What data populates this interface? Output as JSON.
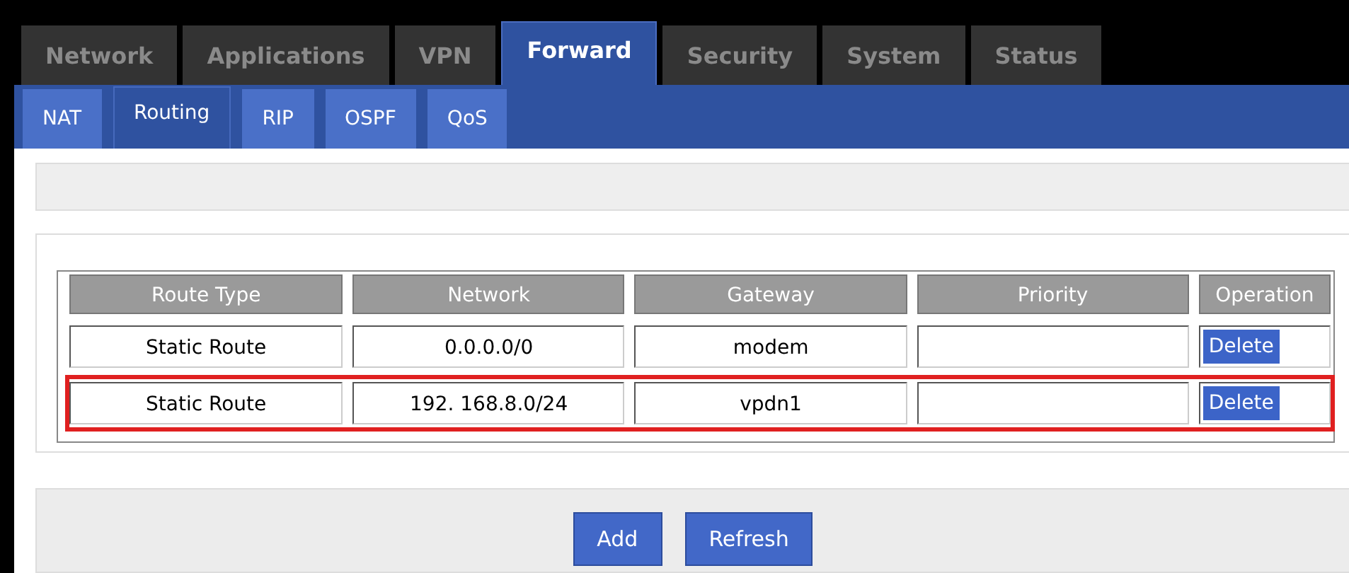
{
  "tabs": [
    {
      "label": "Network",
      "selected": false
    },
    {
      "label": "Applications",
      "selected": false
    },
    {
      "label": "VPN",
      "selected": false
    },
    {
      "label": "Forward",
      "selected": true
    },
    {
      "label": "Security",
      "selected": false
    },
    {
      "label": "System",
      "selected": false
    },
    {
      "label": "Status",
      "selected": false
    }
  ],
  "subtabs": [
    {
      "label": "NAT",
      "selected": false
    },
    {
      "label": "Routing",
      "selected": true
    },
    {
      "label": "RIP",
      "selected": false
    },
    {
      "label": "OSPF",
      "selected": false
    },
    {
      "label": "QoS",
      "selected": false
    }
  ],
  "table": {
    "columns": [
      "Route Type",
      "Network",
      "Gateway",
      "Priority",
      "Operation"
    ],
    "rows": [
      {
        "route_type": "Static Route",
        "network": "0.0.0.0/0",
        "gateway": "modem",
        "priority": "",
        "action": "Delete",
        "highlighted": false
      },
      {
        "route_type": "Static Route",
        "network": "192. 168.8.0/24",
        "gateway": "vpdn1",
        "priority": "",
        "action": "Delete",
        "highlighted": true
      }
    ]
  },
  "buttons": [
    "Add",
    "Refresh"
  ]
}
